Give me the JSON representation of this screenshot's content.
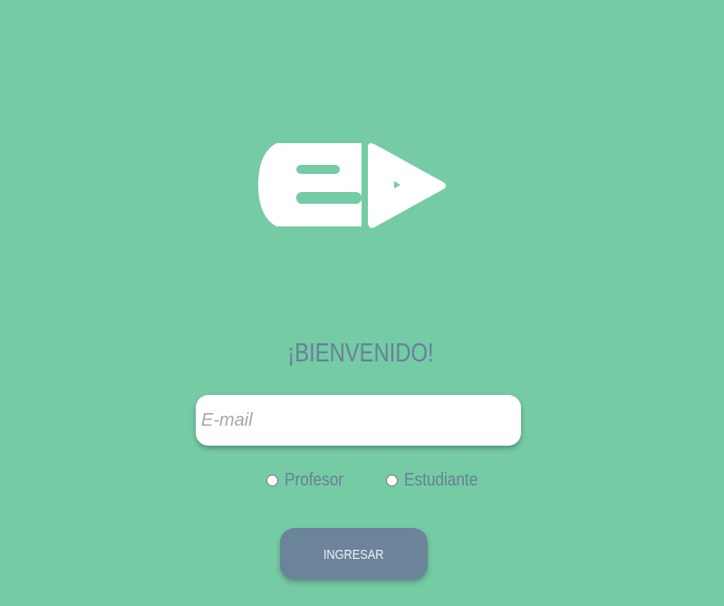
{
  "logo": {
    "icon": "app-logo-icon",
    "color": "#ffffff"
  },
  "welcome_title": "¡BIENVENIDO!",
  "email": {
    "placeholder": "E-mail",
    "value": ""
  },
  "roles": [
    {
      "label": "Profesor",
      "checked": false
    },
    {
      "label": "Estudiante",
      "checked": false
    }
  ],
  "submit_label": "INGRESAR",
  "colors": {
    "background": "#75cba4",
    "accent": "#66809a",
    "button": "#6b8499"
  }
}
